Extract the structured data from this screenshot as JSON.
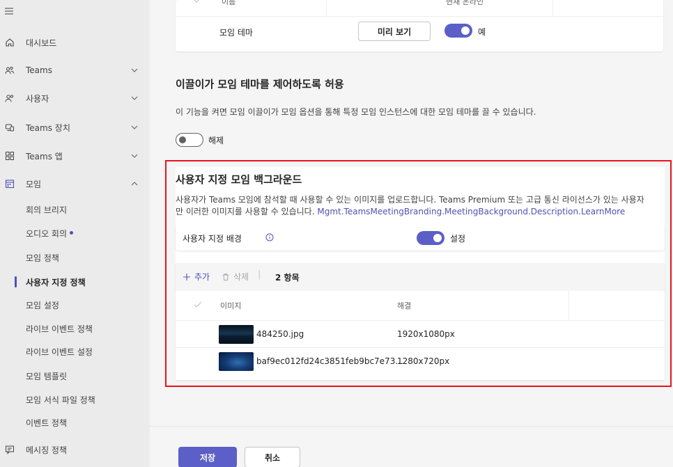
{
  "sidebar": {
    "items": [
      {
        "label": "대시보드",
        "icon": "home-icon"
      },
      {
        "label": "Teams",
        "icon": "teams-icon"
      },
      {
        "label": "사용자",
        "icon": "users-icon"
      },
      {
        "label": "Teams 장치",
        "icon": "devices-icon"
      },
      {
        "label": "Teams 앱",
        "icon": "apps-icon"
      },
      {
        "label": "모임",
        "icon": "calendar-icon"
      }
    ],
    "meeting_sub": [
      {
        "label": "회의 브리지"
      },
      {
        "label": "오디오 회의"
      },
      {
        "label": "모임 정책"
      },
      {
        "label": "사용자 지정 정책"
      },
      {
        "label": "모임 설정"
      },
      {
        "label": "라이브 이벤트 정책"
      },
      {
        "label": "라이브 이벤트 설정"
      },
      {
        "label": "모임 템플릿"
      },
      {
        "label": "모임 서식 파일 정책"
      },
      {
        "label": "이벤트 정책"
      }
    ],
    "messaging": {
      "label": "메시징 정책",
      "icon": "chat-icon"
    }
  },
  "top_table": {
    "header_col1": "이름",
    "header_col3": "현재 온라인",
    "row_label": "모임 테마",
    "preview_label": "미리 보기",
    "toggle_label": "예"
  },
  "organizer_section": {
    "title": "이끌이가 모임 테마를 제어하도록 허용",
    "description": "이 기능을 켜면 모임 이끌이가 모임 옵션을 통해 특정 모임 인스턴스에 대한 모임 테마를 끌 수 있습니다.",
    "toggle_label": "해제"
  },
  "background_section": {
    "title": "사용자 지정 모임 백그라운드",
    "description_line1": "사용자가 Teams 모임에 참석할 때 사용할 수 있는 이미지를 업로드합니다. Teams Premium 또는 고급 통신 라이선스가 있는 사용자",
    "description_line2": "만 이러한 이미지를 사용할 수 있습니다.",
    "learn_more": "Mgmt.TeamsMeetingBranding.MeetingBackground.Description.LearnMore",
    "setting_label": "사용자 지정 배경",
    "setting_toggle_label": "설정",
    "toolbar": {
      "add": "추가",
      "delete": "삭제",
      "count": "2 항목"
    },
    "columns": [
      "이미지",
      "해결"
    ],
    "rows": [
      {
        "name": "484250.jpg",
        "resolution": "1920x1080px"
      },
      {
        "name": "baf9ec012fd24c3851feb9bc7e73...",
        "resolution": "1280x720px"
      }
    ]
  },
  "footer": {
    "save": "저장",
    "cancel": "취소"
  },
  "colors": {
    "accent": "#5b5fc7",
    "highlight_border": "#e8141b",
    "link": "#4f52b2"
  }
}
